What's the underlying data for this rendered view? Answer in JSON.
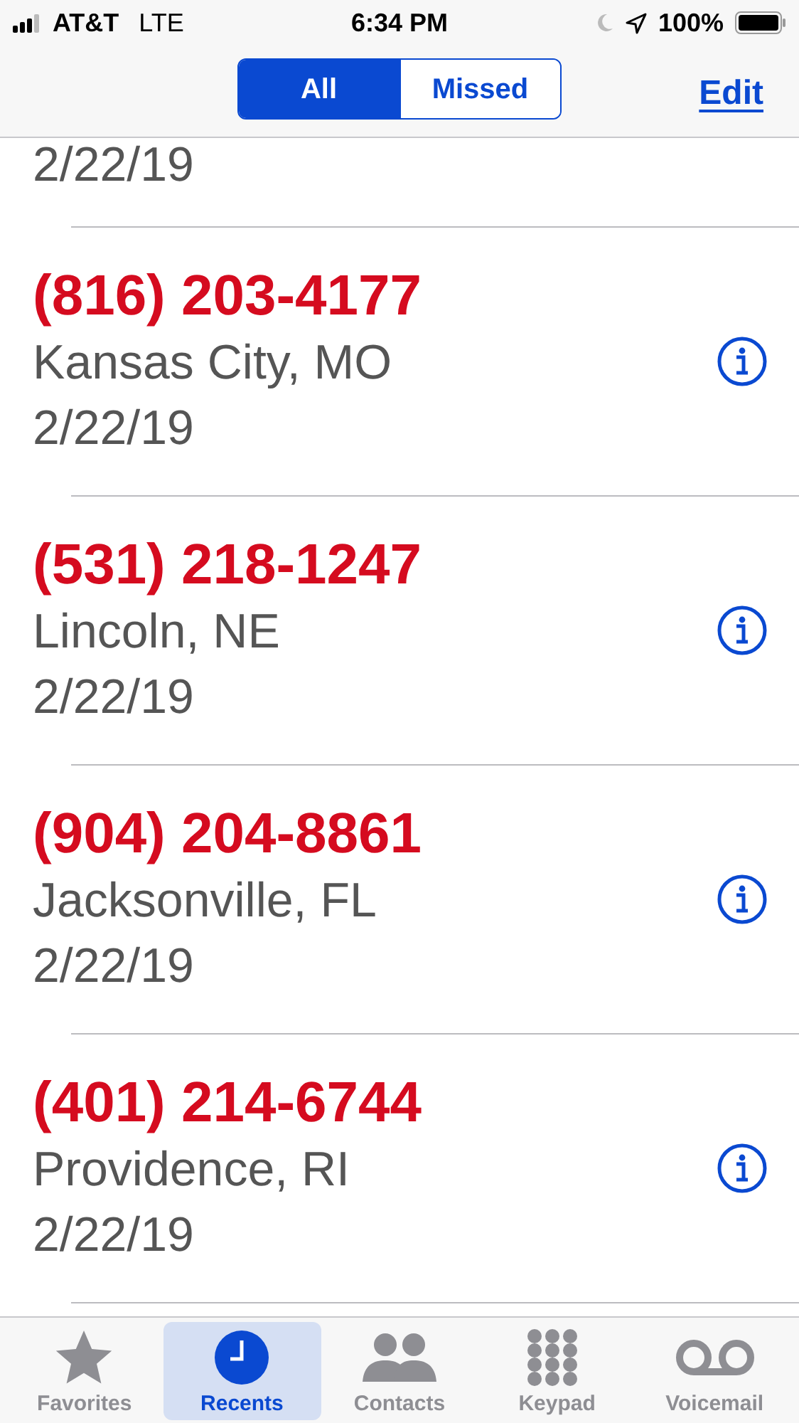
{
  "status_bar": {
    "carrier": "AT&T",
    "network": "LTE",
    "time": "6:34 PM",
    "battery": "100%"
  },
  "nav": {
    "segments": [
      {
        "label": "All",
        "selected": true
      },
      {
        "label": "Missed",
        "selected": false
      }
    ],
    "edit": "Edit"
  },
  "cut_row": {
    "date": "2/22/19"
  },
  "calls": [
    {
      "number": "(816) 203-4177",
      "location": "Kansas City, MO",
      "date": "2/22/19",
      "missed": true
    },
    {
      "number": "(531) 218-1247",
      "location": "Lincoln, NE",
      "date": "2/22/19",
      "missed": true
    },
    {
      "number": "(904) 204-8861",
      "location": "Jacksonville, FL",
      "date": "2/22/19",
      "missed": true
    },
    {
      "number": "(401) 214-6744",
      "location": "Providence, RI",
      "date": "2/22/19",
      "missed": true
    }
  ],
  "tab_bar": [
    {
      "label": "Favorites",
      "kind": "star",
      "selected": false
    },
    {
      "label": "Recents",
      "kind": "clock",
      "selected": true
    },
    {
      "label": "Contacts",
      "kind": "people",
      "selected": false
    },
    {
      "label": "Keypad",
      "kind": "keypad",
      "selected": false
    },
    {
      "label": "Voicemail",
      "kind": "voicemail",
      "selected": false
    }
  ]
}
